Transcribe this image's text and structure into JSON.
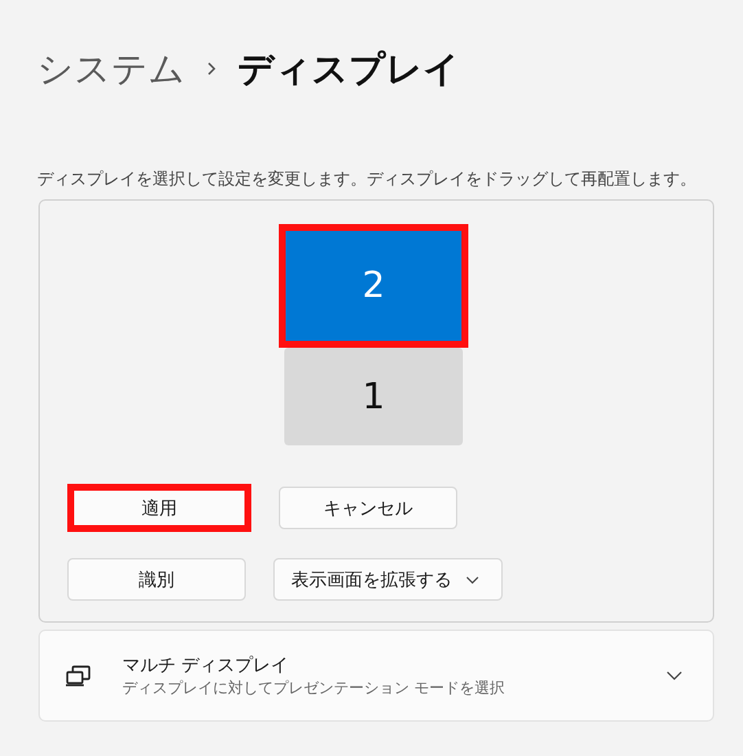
{
  "breadcrumb": [
    {
      "label": "システム",
      "current": false
    },
    {
      "label": "ディスプレイ",
      "current": true
    }
  ],
  "description": "ディスプレイを選択して設定を変更します。ディスプレイをドラッグして再配置します。",
  "monitors": [
    {
      "label": "2",
      "selected": true,
      "highlighted": true
    },
    {
      "label": "1",
      "selected": false,
      "highlighted": false
    }
  ],
  "buttons": [
    {
      "label": "適用",
      "highlighted": true
    },
    {
      "label": "キャンセル",
      "highlighted": false
    }
  ],
  "identify_button": "識別",
  "mode_dropdown": {
    "value": "表示画面を拡張する"
  },
  "multi_display": {
    "title": "マルチ ディスプレイ",
    "subtitle": "ディスプレイに対してプレゼンテーション モードを選択",
    "expanded": false
  }
}
